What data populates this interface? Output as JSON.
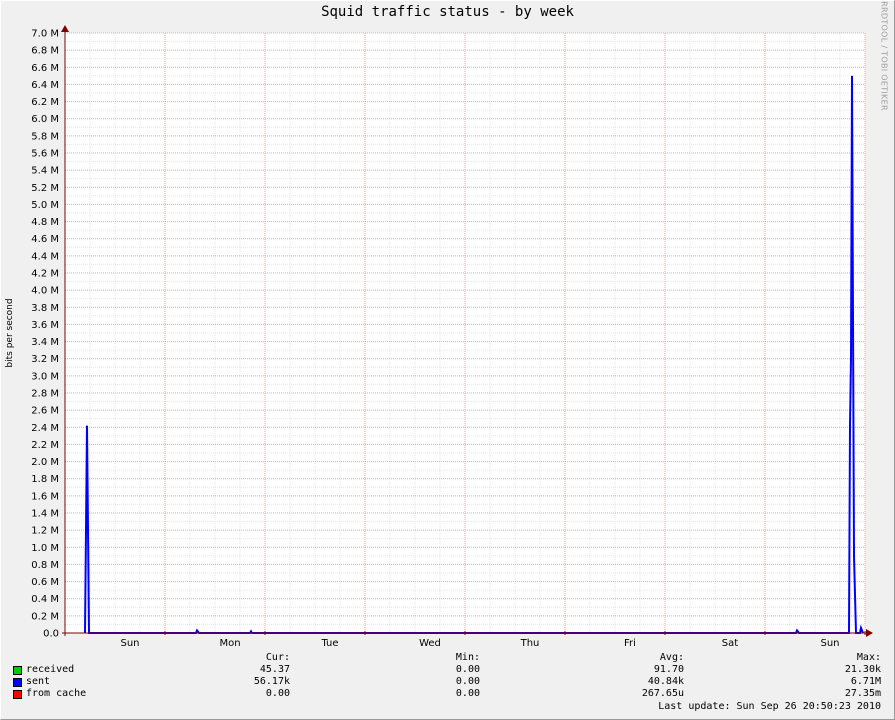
{
  "chart_data": {
    "type": "line",
    "title": "Squid traffic status - by week",
    "ylabel": "bits per second",
    "xlabel": "",
    "watermark": "RRDTOOL / TOBI OETIKER",
    "ylim": [
      0,
      7000000
    ],
    "y_ticks": [
      "0.0",
      "0.2 M",
      "0.4 M",
      "0.6 M",
      "0.8 M",
      "1.0 M",
      "1.2 M",
      "1.4 M",
      "1.6 M",
      "1.8 M",
      "2.0 M",
      "2.2 M",
      "2.4 M",
      "2.6 M",
      "2.8 M",
      "3.0 M",
      "3.2 M",
      "3.4 M",
      "3.6 M",
      "3.8 M",
      "4.0 M",
      "4.2 M",
      "4.4 M",
      "4.6 M",
      "4.8 M",
      "5.0 M",
      "5.2 M",
      "5.4 M",
      "5.6 M",
      "5.8 M",
      "6.0 M",
      "6.2 M",
      "6.4 M",
      "6.6 M",
      "6.8 M",
      "7.0 M"
    ],
    "x_ticks": [
      "Sun",
      "Mon",
      "Tue",
      "Wed",
      "Thu",
      "Fri",
      "Sat",
      "Sun"
    ],
    "grid": true,
    "colors": {
      "background": "#ffffff",
      "minor_grid": "#e5e5e5",
      "major_grid": "#f0a0a0",
      "axis": "#800000",
      "received": "#00cc00",
      "sent": "#0000ff",
      "from_cache": "#ff0000"
    },
    "series": [
      {
        "name": "sent",
        "color": "#0000ff",
        "points": [
          [
            -0.45,
            0
          ],
          [
            -0.43,
            2420000
          ],
          [
            -0.41,
            0
          ],
          [
            0.66,
            0
          ],
          [
            0.67,
            30000
          ],
          [
            0.69,
            0
          ],
          [
            1.2,
            0
          ],
          [
            1.21,
            20000
          ],
          [
            1.22,
            0
          ],
          [
            6.66,
            0
          ],
          [
            6.67,
            30000
          ],
          [
            6.69,
            0
          ],
          [
            7.19,
            0
          ],
          [
            7.2,
            2420000
          ],
          [
            7.21,
            3200000
          ],
          [
            7.22,
            6500000
          ],
          [
            7.24,
            900000
          ],
          [
            7.26,
            0
          ],
          [
            7.3,
            0
          ],
          [
            7.31,
            60000
          ],
          [
            7.33,
            0
          ]
        ]
      }
    ],
    "legend": {
      "headers": {
        "cur": "Cur:",
        "min": "Min:",
        "avg": "Avg:",
        "max": "Max:"
      },
      "rows": [
        {
          "name": "received",
          "color": "#00cc00",
          "cur": "45.37",
          "min": "0.00",
          "avg": "91.70",
          "max": "21.30k"
        },
        {
          "name": "sent",
          "color": "#0000ff",
          "cur": "56.17k",
          "min": "0.00",
          "avg": "40.84k",
          "max": "6.71M"
        },
        {
          "name": "from cache",
          "color": "#ff0000",
          "cur": "0.00",
          "min": "0.00",
          "avg": "267.65u",
          "max": "27.35m"
        }
      ]
    },
    "last_update": "Last update: Sun Sep 26 20:50:23 2010"
  }
}
